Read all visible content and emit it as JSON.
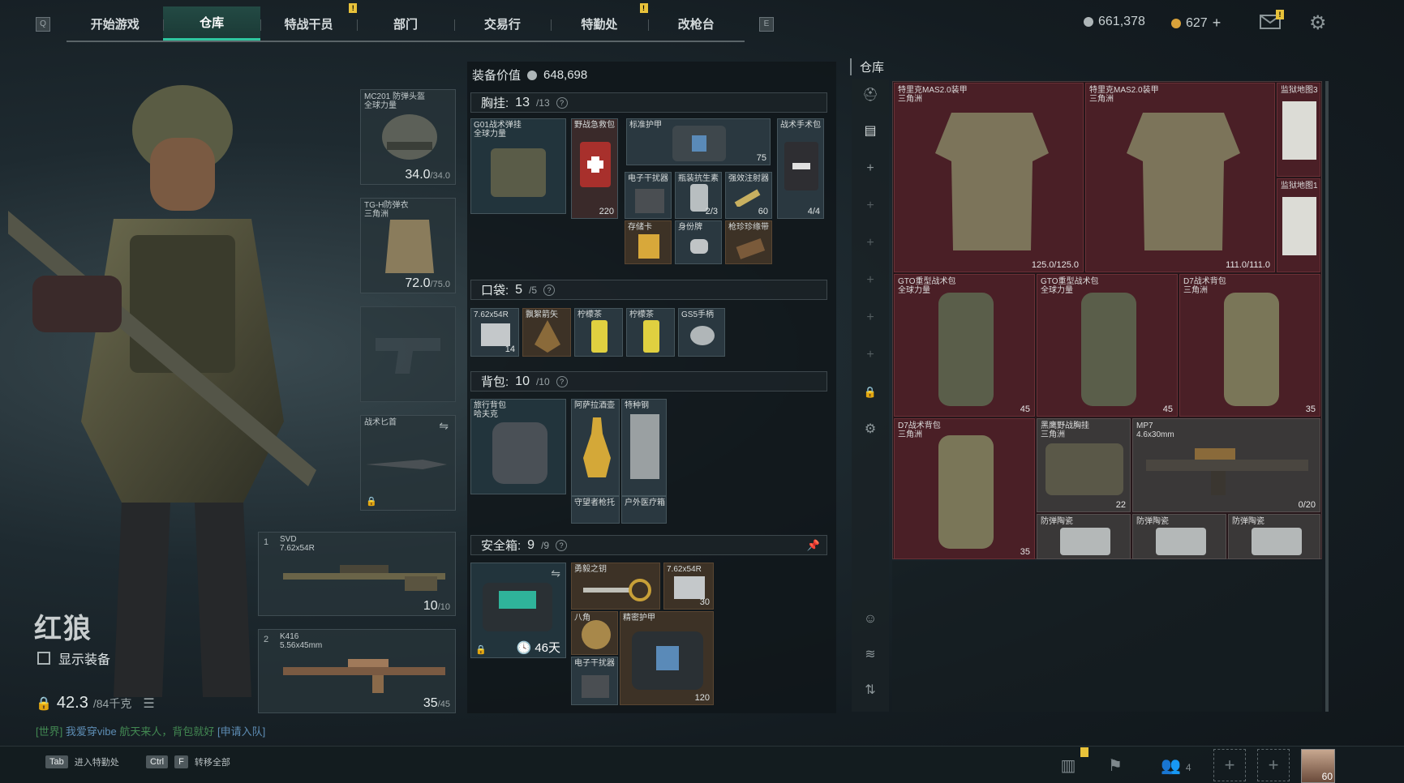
{
  "topbar": {
    "left_key": "Q",
    "right_key": "E",
    "tabs": [
      {
        "label": "开始游戏",
        "badge": ""
      },
      {
        "label": "仓库",
        "badge": ""
      },
      {
        "label": "特战干员",
        "badge": "!"
      },
      {
        "label": "部门",
        "badge": ""
      },
      {
        "label": "交易行",
        "badge": ""
      },
      {
        "label": "特勤处",
        "badge": "!"
      },
      {
        "label": "改枪台",
        "badge": ""
      }
    ],
    "currency_silver": "661,378",
    "currency_gold": "627",
    "currency_add": "+",
    "mail_badge": "!"
  },
  "character": {
    "name": "红狼",
    "show_equipment": "显示装备",
    "weight_current": "42.3",
    "weight_max": "/84千克",
    "chat_channel": "[世界]",
    "chat_user": "我爱穿vibe",
    "chat_text": "航天来人，背包就好",
    "chat_link": "[申请入队]"
  },
  "equipment": {
    "helmet": {
      "name": "MC201 防弹头盔",
      "sub": "全球力量",
      "dur": "34.0",
      "dur_max": "/34.0"
    },
    "armor": {
      "name": "TG-H防弹衣",
      "sub": "三角洲",
      "dur": "72.0",
      "dur_max": "/75.0"
    },
    "melee": {
      "name": "战术匕首"
    },
    "weapon1": {
      "slot": "1",
      "name": "SVD",
      "ammo": "7.62x54R",
      "count": "10",
      "count_max": "/10"
    },
    "weapon2": {
      "slot": "2",
      "name": "K416",
      "ammo": "5.56x45mm",
      "count": "35",
      "count_max": "/45"
    }
  },
  "loadout": {
    "value_label": "装备价值",
    "value": "648,698",
    "chest": {
      "label": "胸挂:",
      "count": "13",
      "max": "/13"
    },
    "pocket": {
      "label": "口袋:",
      "count": "5",
      "max": "/5"
    },
    "backpack": {
      "label": "背包:",
      "count": "10",
      "max": "/10"
    },
    "safebox": {
      "label": "安全箱:",
      "count": "9",
      "max": "/9",
      "days": "46天"
    },
    "chest_items": [
      {
        "name": "G01战术弹挂",
        "sub": "全球力量",
        "count": ""
      },
      {
        "name": "野战急救包",
        "count": "220"
      },
      {
        "name": "标准护甲",
        "count": "75"
      },
      {
        "name": "战术手术包",
        "count": "4/4"
      },
      {
        "name": "电子干扰器",
        "count": ""
      },
      {
        "name": "瓶装抗生素",
        "count": "2/3"
      },
      {
        "name": "强效注射器",
        "count": "60"
      },
      {
        "name": "存储卡",
        "count": ""
      },
      {
        "name": "身份牌",
        "count": ""
      },
      {
        "name": "枪珍珍缘带",
        "count": ""
      }
    ],
    "pocket_items": [
      {
        "name": "7.62x54R",
        "count": "14"
      },
      {
        "name": "飘絮箭矢",
        "count": ""
      },
      {
        "name": "柠檬茶",
        "count": ""
      },
      {
        "name": "柠檬茶",
        "count": ""
      },
      {
        "name": "GS5手柄",
        "count": ""
      }
    ],
    "backpack_items": [
      {
        "name": "旅行背包",
        "sub": "哈夫克",
        "count": ""
      },
      {
        "name": "阿萨拉酒壶",
        "count": ""
      },
      {
        "name": "特种钢",
        "count": ""
      },
      {
        "name": "守望者枪托",
        "count": ""
      },
      {
        "name": "户外医疗箱",
        "count": ""
      }
    ],
    "safe_items": [
      {
        "name": "勇毅之钥",
        "count": ""
      },
      {
        "name": "7.62x54R",
        "count": "30"
      },
      {
        "name": "八角",
        "count": ""
      },
      {
        "name": "精密护甲",
        "count": "120"
      },
      {
        "name": "电子干扰器",
        "count": ""
      }
    ]
  },
  "warehouse": {
    "title": "仓库",
    "items": [
      {
        "name": "特里克MAS2.0装甲",
        "sub": "三角洲",
        "count": "125.0/125.0"
      },
      {
        "name": "特里克MAS2.0装甲",
        "sub": "三角洲",
        "count": "111.0/111.0"
      },
      {
        "name": "监狱地图3",
        "sub": "",
        "count": ""
      },
      {
        "name": "监狱地图1",
        "sub": "",
        "count": ""
      },
      {
        "name": "GTO重型战术包",
        "sub": "全球力量",
        "count": "45"
      },
      {
        "name": "GTO重型战术包",
        "sub": "全球力量",
        "count": "45"
      },
      {
        "name": "D7战术背包",
        "sub": "三角洲",
        "count": "35"
      },
      {
        "name": "D7战术背包",
        "sub": "三角洲",
        "count": "35"
      },
      {
        "name": "黑鹰野战胸挂",
        "sub": "三角洲",
        "count": "22"
      },
      {
        "name": "MP7",
        "sub": "4.6x30mm",
        "count": "0/20"
      },
      {
        "name": "防弹陶瓷",
        "sub": "",
        "count": ""
      },
      {
        "name": "防弹陶瓷",
        "sub": "",
        "count": ""
      },
      {
        "name": "防弹陶瓷",
        "sub": "",
        "count": ""
      }
    ]
  },
  "bottombar": {
    "tab_key": "Tab",
    "tab_label": "进入特勤处",
    "ctrl_key": "Ctrl",
    "f_key": "F",
    "transfer_label": "转移全部",
    "squad_count": "4",
    "avatar_level": "60"
  }
}
